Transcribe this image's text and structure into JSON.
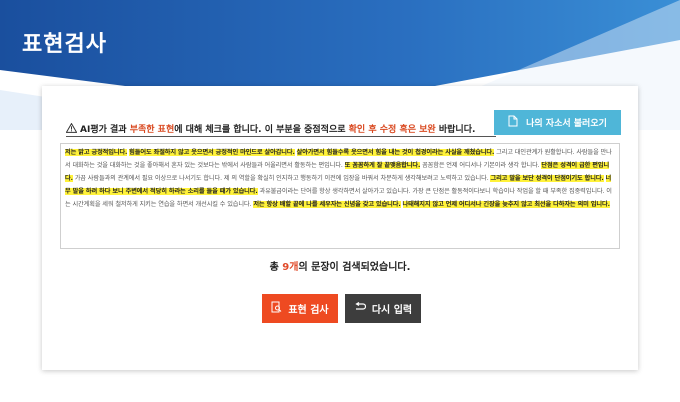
{
  "page": {
    "title": "표현검사",
    "colors": {
      "header_dark": "#1a4f9e",
      "header_light": "#3a8fd6",
      "accent": "#ee4a21",
      "highlight": "#fff23a",
      "info_button": "#4fb6d8",
      "dark_button": "#3d3d3d"
    }
  },
  "notice": {
    "icon": "warning-icon",
    "part1": "AI평가 결과 ",
    "emph1": "부족한 표현",
    "part2": "에 대해 체크를 합니다. 이 부분을 중점적으로 ",
    "emph2": "확인 후 수정 혹은 보완",
    "part3": " 바랍니다."
  },
  "load_button": {
    "icon": "document-icon",
    "label": "나의 자소서 불러오기"
  },
  "text_box": {
    "segments": [
      {
        "text": "저는 밝고 긍정적입니다.",
        "highlight": true
      },
      {
        "text": " ",
        "highlight": false
      },
      {
        "text": "힘들어도 좌절하지 않고 웃으면서 긍정적인 마인드로 살아갑니다.",
        "highlight": true
      },
      {
        "text": " ",
        "highlight": false
      },
      {
        "text": "살아가면서 힘들수록 웃으면서 힘을 내는 것이 첩경이라는 사실을 깨쳤습니다.",
        "highlight": true
      },
      {
        "text": " 그리고 대인관계가 원활합니다. 사람들을 만나서 대화하는 것을 대화하는 것을 좋아해서 혼자 있는 것보다는 밖에서 사람들과 어울리면서 활동하는 편입니다. ",
        "highlight": false
      },
      {
        "text": "또 꼼꼼하게 잘 끝맺음합니다.",
        "highlight": true
      },
      {
        "text": " 꼼꼼함은 언제 어디서나 기본이라 생각 합니다. ",
        "highlight": false
      },
      {
        "text": "단점은 성격이 급한 편입니다.",
        "highlight": true
      },
      {
        "text": " 가끔 사람들과의 관계에서 필요 이상으로 나서기도 합니다. 제 의 역할을 확실히 인지하고 행동하기 이전에 입장을 바꿔서 차분하게 생각해보려고 노력하고 있습니다. ",
        "highlight": false
      },
      {
        "text": "그리고 말을 보단 성격이 단점이기도 합니다.",
        "highlight": true
      },
      {
        "text": " ",
        "highlight": false
      },
      {
        "text": "너무 말을 하려 하다 보니 주변에서 적당히 하라는 소리를 들을 때가 있습니다.",
        "highlight": true
      },
      {
        "text": " 과유불급이라는 단어를 항상 생각하면서 살아가고 있습니다. 가장 큰 단점은 활동적이다보니 학습이나 작업을 할 때 부족한 집중력입니다. 이는 시간계획을 세워 철저하게 지키는 연습을 하면서 개선시킬 수 있습니다. ",
        "highlight": false
      },
      {
        "text": "저는 항상 배할 끝에 나를 세우자는 신념을 갖고 있습니다.",
        "highlight": true
      },
      {
        "text": " ",
        "highlight": false
      },
      {
        "text": "나태해지지 않고 언제 어디서나 긴장을 늦추지 않고 최선을 다하자는 의미 입니다.",
        "highlight": true
      }
    ]
  },
  "summary": {
    "prefix": "총 ",
    "count": "9개",
    "suffix": "의 문장이 검색되었습니다."
  },
  "buttons": {
    "check": {
      "icon": "document-search-icon",
      "label": "표현 검사"
    },
    "reset": {
      "icon": "undo-arrow-icon",
      "label": "다시 입력"
    }
  }
}
